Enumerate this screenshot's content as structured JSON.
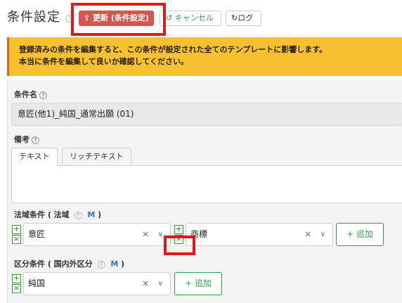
{
  "header": {
    "title": "条件設定",
    "help_symbol": "?",
    "update_icon": "upload-icon",
    "update_label": "更新 (条件設定)",
    "cancel_icon": "undo-icon",
    "cancel_label": "キャンセル",
    "log_icon": "history-icon",
    "log_label": "ログ"
  },
  "warning": {
    "line1": "登録済みの条件を編集すると、この条件が設定された全てのテンプレートに影響します。",
    "line2": "本当に条件を編集して良いか確認してください。",
    "accent_color": "#e5602c",
    "background_color": "#f8c130"
  },
  "form": {
    "name_label": "条件名",
    "name_value": "意匠(他1)_純国_通常出願 (01)",
    "notes_label": "備考",
    "notes_tabs": [
      {
        "label": "テキスト",
        "active": true
      },
      {
        "label": "リッチテキスト",
        "active": false
      }
    ],
    "notes_value": "",
    "law_label": "法域条件 ( 法域",
    "law_suffix": ")",
    "law_marker": "M",
    "law_selects": [
      {
        "value": "意匠"
      },
      {
        "value": "商標"
      }
    ],
    "law_add_label": "+ 追加",
    "division_label": "区分条件 ( 国内外区分",
    "division_suffix": ")",
    "division_marker": "M",
    "division_selects": [
      {
        "value": "純国"
      }
    ],
    "division_add_label": "+ 追加",
    "add_symbol": "+",
    "remove_symbol": "×",
    "clear_symbol": "×",
    "chevron_symbol": "∨"
  },
  "colors": {
    "update_button": "#d9534f",
    "highlight": "#e3171b",
    "success_green": "#2e9a4e",
    "marker_blue": "#3a6fd8"
  }
}
